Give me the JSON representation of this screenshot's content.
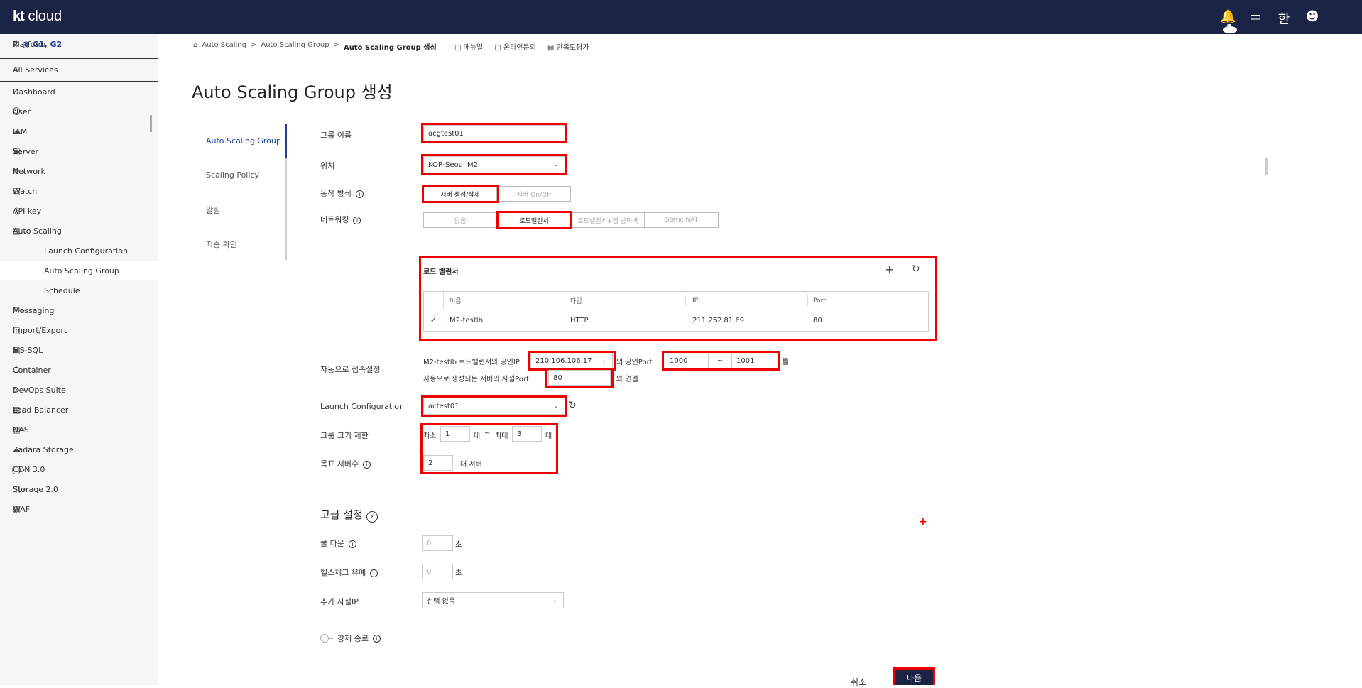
{
  "topbar": {
    "logo_bold": "kt",
    "logo_rest": " cloud",
    "notif_count": "1"
  },
  "sidebar": {
    "platform": {
      "label": "Platform",
      "value": "@ G1, G2"
    },
    "all_services": "All Services",
    "items": [
      {
        "label": "Dashboard",
        "icon": "home-icon"
      },
      {
        "label": "User",
        "icon": "user-icon"
      },
      {
        "label": "IAM",
        "icon": "cloud-icon"
      },
      {
        "label": "Server",
        "icon": "chip-icon"
      },
      {
        "label": "Network",
        "icon": "network-icon"
      },
      {
        "label": "Watch",
        "icon": "monitor-icon"
      },
      {
        "label": "API key",
        "icon": "key-icon"
      },
      {
        "label": "Auto Scaling",
        "icon": "autoscaling-icon"
      },
      {
        "label": "Launch Configuration"
      },
      {
        "label": "Auto Scaling Group"
      },
      {
        "label": "Schedule"
      },
      {
        "label": "Messaging",
        "icon": "mail-icon"
      },
      {
        "label": "Import/Export",
        "icon": "box-icon"
      },
      {
        "label": "MS-SQL",
        "icon": "chip-icon"
      },
      {
        "label": "Container",
        "icon": "container-icon"
      },
      {
        "label": "DevOps Suite",
        "icon": "infinity-icon"
      },
      {
        "label": "Load Balancer",
        "icon": "loadbalancer-icon"
      },
      {
        "label": "NAS",
        "icon": "nas-icon"
      },
      {
        "label": "Zadara Storage",
        "icon": "cloud-storage-icon"
      },
      {
        "label": "CDN 3.0",
        "icon": "cdn-icon"
      },
      {
        "label": "Storage 2.0",
        "icon": "storage-icon"
      },
      {
        "label": "WAF",
        "icon": "waf-icon"
      }
    ]
  },
  "breadcrumb": {
    "b1": "Auto Scaling",
    "sep": ">",
    "b2": "Auto Scaling Group",
    "b3": "Auto Scaling Group 생성"
  },
  "links": {
    "manual": "매뉴얼",
    "inquiry": "온라인문의",
    "survey": "만족도평가"
  },
  "page_title": "Auto Scaling Group 생성",
  "tabs": [
    "Auto Scaling Group",
    "Scaling Policy",
    "알림",
    "최종 확인"
  ],
  "form": {
    "group_name_label": "그룹 이름",
    "group_name_value": "acgtest01",
    "location_label": "위치",
    "location_value": "KOR-Seoul M2",
    "operation_label": "동작 방식",
    "operation_opts": [
      "서버 생성/삭제",
      "서버 On/Off"
    ],
    "networking_label": "네트워킹",
    "networking_opts": [
      "없음",
      "로드밸런서",
      "로드밸런서+웹 방화벽",
      "Static NAT"
    ],
    "lb_title": "로드 밸런서",
    "lb_columns": [
      "이름",
      "타입",
      "IP",
      "Port"
    ],
    "lb_row": {
      "name": "M2-testlb",
      "type": "HTTP",
      "ip": "211.252.81.69",
      "port": "80"
    },
    "auto_connect_label": "자동으로 접속설정",
    "auto_line1_pre": "M2-testlb 로드밸런서와 공인IP",
    "public_ip": "210.106.106.17",
    "auto_line1_mid": "의 공인Port",
    "port_from": "1000",
    "port_tilde": "~",
    "port_to": "1001",
    "auto_line1_post": "를",
    "auto_line2_pre": "자동으로 생성되는 서버의 사설Port",
    "private_port": "80",
    "auto_line2_post": "와 연결",
    "launch_config_label": "Launch Configuration",
    "launch_config_value": "actest01",
    "group_size_label": "그룹 크기 제한",
    "min_label": "최소",
    "min_value": "1",
    "unit": "대",
    "range_sep": "~",
    "max_label": "최대",
    "max_value": "3",
    "target_label": "목표 서버수",
    "target_value": "2",
    "target_unit": "대 서버"
  },
  "advanced": {
    "title": "고급 설정",
    "cooldown_label": "쿨 다운",
    "cooldown_value": "0",
    "sec": "초",
    "health_label": "헬스체크 유예",
    "health_value": "0",
    "extra_ip_label": "추가 사설IP",
    "extra_ip_value": "선택 없음",
    "force_label": "강제 종료"
  },
  "buttons": {
    "cancel": "취소",
    "next": "다음"
  },
  "colors": {
    "navy": "#1c2445",
    "highlight": "#ee0000",
    "active_tab": "#1c3f94"
  }
}
